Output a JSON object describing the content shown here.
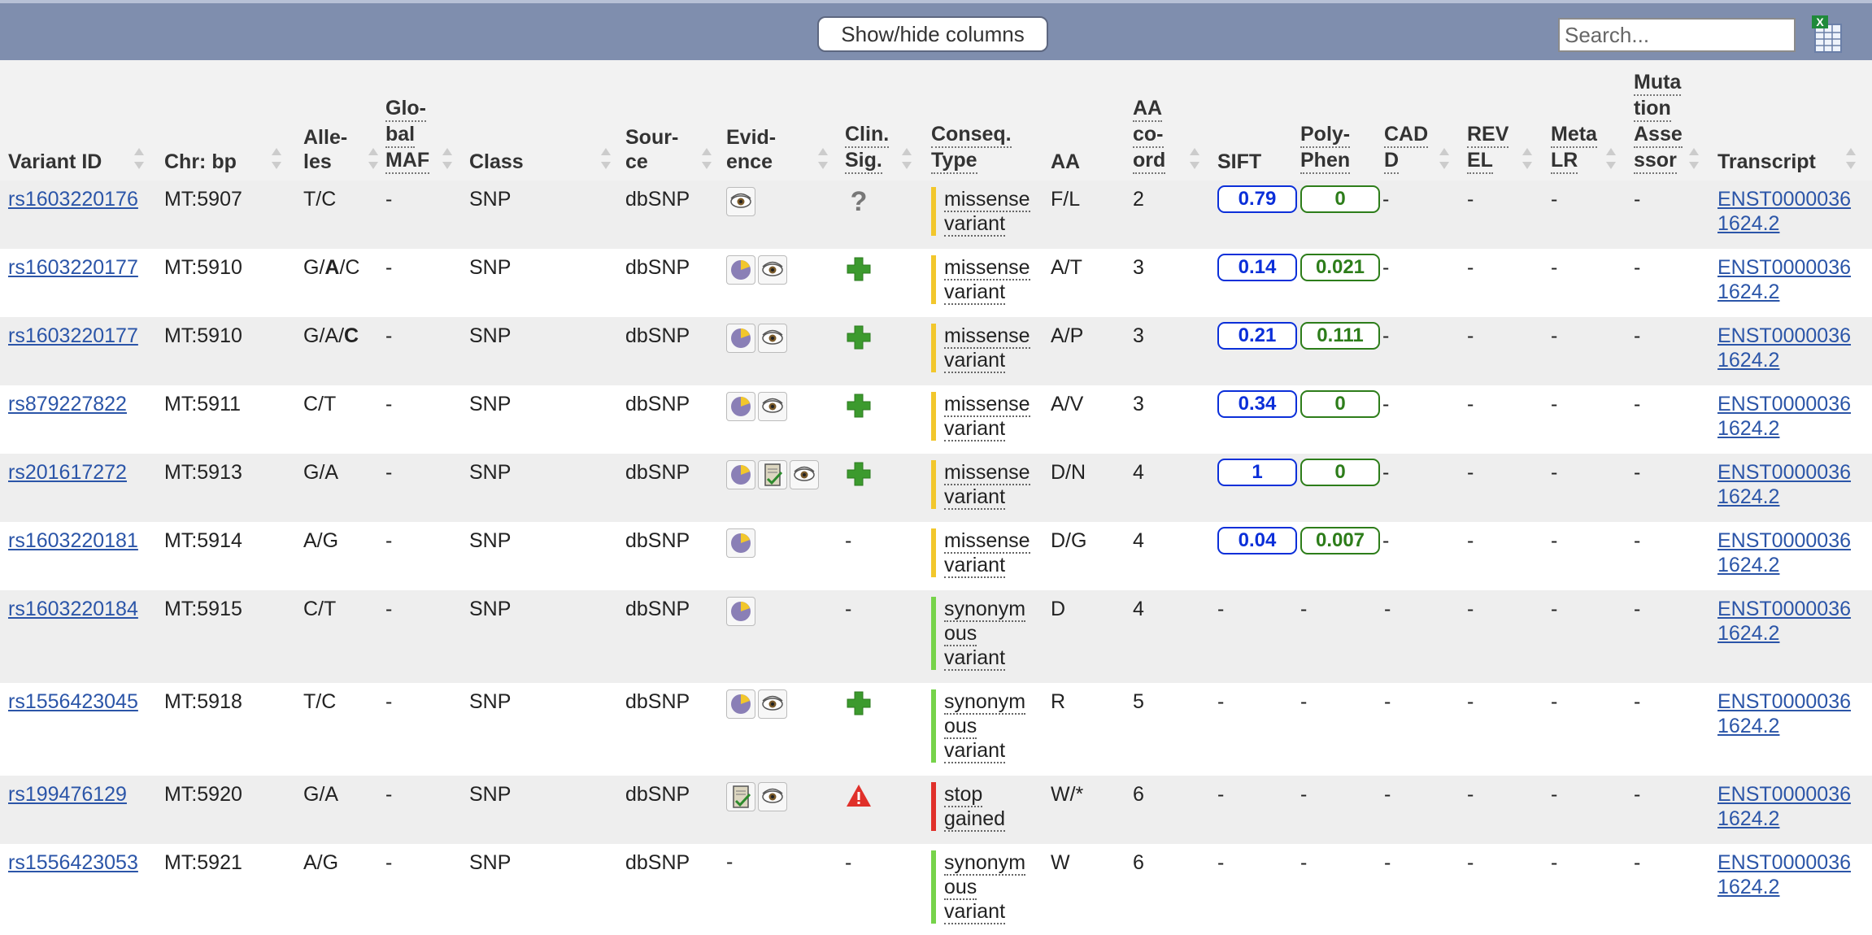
{
  "toolbar": {
    "show_hide_label": "Show/hide columns",
    "search_placeholder": "Search...",
    "export_icon": "excel-export-icon"
  },
  "columns": [
    {
      "key": "variant_id",
      "lines": [
        "Variant ID"
      ]
    },
    {
      "key": "chr_bp",
      "lines": [
        "Chr: bp"
      ]
    },
    {
      "key": "alleles",
      "lines": [
        "Alle-",
        "les"
      ]
    },
    {
      "key": "global_maf",
      "lines": [
        "Glo-",
        "bal",
        "MAF"
      ]
    },
    {
      "key": "class",
      "lines": [
        "Class"
      ]
    },
    {
      "key": "source",
      "lines": [
        "Sour-",
        "ce"
      ]
    },
    {
      "key": "evidence",
      "lines": [
        "Evid-",
        "ence"
      ]
    },
    {
      "key": "clin_sig",
      "lines": [
        "Clin.",
        "Sig."
      ]
    },
    {
      "key": "conseq",
      "lines": [
        "Conseq.",
        "Type"
      ]
    },
    {
      "key": "aa",
      "lines": [
        "AA"
      ]
    },
    {
      "key": "aa_coord",
      "lines": [
        "AA",
        "co-",
        "ord"
      ]
    },
    {
      "key": "sift",
      "lines": [
        "SIFT"
      ]
    },
    {
      "key": "polyphen",
      "lines": [
        "Poly-",
        "Phen"
      ]
    },
    {
      "key": "cadd",
      "lines": [
        "CAD",
        "D"
      ]
    },
    {
      "key": "revel",
      "lines": [
        "REV",
        "EL"
      ]
    },
    {
      "key": "metalr",
      "lines": [
        "Meta",
        "LR"
      ]
    },
    {
      "key": "mutass",
      "lines": [
        "Muta",
        "tion",
        "Asse",
        "ssor"
      ]
    },
    {
      "key": "transcript",
      "lines": [
        "Transcript"
      ]
    }
  ],
  "rows": [
    {
      "id": "rs1603220176",
      "chr": "MT:5907",
      "alleles": [
        "T/C"
      ],
      "maf": "-",
      "class": "SNP",
      "source": "dbSNP",
      "evidence": [
        "eye-icon"
      ],
      "clin": "uncertain-icon",
      "conseq": [
        "missense",
        "variant"
      ],
      "conseq_color": "#f2c72c",
      "aa": "F/L",
      "coord": "2",
      "sift": "0.79",
      "polyphen": "0",
      "cadd": "-",
      "revel": "-",
      "metalr": "-",
      "mutass": "-",
      "transcript": [
        "ENST0000036",
        "1624.2"
      ]
    },
    {
      "id": "rs1603220177",
      "chr": "MT:5910",
      "alleles": [
        "G/",
        "A",
        "/C"
      ],
      "maf": "-",
      "class": "SNP",
      "source": "dbSNP",
      "evidence": [
        "frequency-icon",
        "eye-icon"
      ],
      "clin": "benign-cross-icon",
      "conseq": [
        "missense",
        "variant"
      ],
      "conseq_color": "#f2c72c",
      "aa": "A/T",
      "coord": "3",
      "sift": "0.14",
      "polyphen": "0.021",
      "cadd": "-",
      "revel": "-",
      "metalr": "-",
      "mutass": "-",
      "transcript": [
        "ENST0000036",
        "1624.2"
      ]
    },
    {
      "id": "rs1603220177",
      "chr": "MT:5910",
      "alleles": [
        "G/A/",
        "C",
        ""
      ],
      "maf": "-",
      "class": "SNP",
      "source": "dbSNP",
      "evidence": [
        "frequency-icon",
        "eye-icon"
      ],
      "clin": "benign-cross-icon",
      "conseq": [
        "missense",
        "variant"
      ],
      "conseq_color": "#f2c72c",
      "aa": "A/P",
      "coord": "3",
      "sift": "0.21",
      "polyphen": "0.111",
      "cadd": "-",
      "revel": "-",
      "metalr": "-",
      "mutass": "-",
      "transcript": [
        "ENST0000036",
        "1624.2"
      ]
    },
    {
      "id": "rs879227822",
      "chr": "MT:5911",
      "alleles": [
        "C/T"
      ],
      "maf": "-",
      "class": "SNP",
      "source": "dbSNP",
      "evidence": [
        "frequency-icon",
        "eye-icon"
      ],
      "clin": "benign-cross-icon",
      "conseq": [
        "missense",
        "variant"
      ],
      "conseq_color": "#f2c72c",
      "aa": "A/V",
      "coord": "3",
      "sift": "0.34",
      "polyphen": "0",
      "cadd": "-",
      "revel": "-",
      "metalr": "-",
      "mutass": "-",
      "transcript": [
        "ENST0000036",
        "1624.2"
      ]
    },
    {
      "id": "rs201617272",
      "chr": "MT:5913",
      "alleles": [
        "G/A"
      ],
      "maf": "-",
      "class": "SNP",
      "source": "dbSNP",
      "evidence": [
        "frequency-icon",
        "citation-icon",
        "eye-icon"
      ],
      "clin": "benign-cross-icon",
      "conseq": [
        "missense",
        "variant"
      ],
      "conseq_color": "#f2c72c",
      "aa": "D/N",
      "coord": "4",
      "sift": "1",
      "polyphen": "0",
      "cadd": "-",
      "revel": "-",
      "metalr": "-",
      "mutass": "-",
      "transcript": [
        "ENST0000036",
        "1624.2"
      ]
    },
    {
      "id": "rs1603220181",
      "chr": "MT:5914",
      "alleles": [
        "A/G"
      ],
      "maf": "-",
      "class": "SNP",
      "source": "dbSNP",
      "evidence": [
        "frequency-icon"
      ],
      "clin": "-",
      "conseq": [
        "missense",
        "variant"
      ],
      "conseq_color": "#f2c72c",
      "aa": "D/G",
      "coord": "4",
      "sift": "0.04",
      "polyphen": "0.007",
      "cadd": "-",
      "revel": "-",
      "metalr": "-",
      "mutass": "-",
      "transcript": [
        "ENST0000036",
        "1624.2"
      ]
    },
    {
      "id": "rs1603220184",
      "chr": "MT:5915",
      "alleles": [
        "C/T"
      ],
      "maf": "-",
      "class": "SNP",
      "source": "dbSNP",
      "evidence": [
        "frequency-icon"
      ],
      "clin": "-",
      "conseq": [
        "synonym",
        "ous",
        "variant"
      ],
      "conseq_color": "#76d34a",
      "aa": "D",
      "coord": "4",
      "sift": "-",
      "polyphen": "-",
      "cadd": "-",
      "revel": "-",
      "metalr": "-",
      "mutass": "-",
      "transcript": [
        "ENST0000036",
        "1624.2"
      ]
    },
    {
      "id": "rs1556423045",
      "chr": "MT:5918",
      "alleles": [
        "T/C"
      ],
      "maf": "-",
      "class": "SNP",
      "source": "dbSNP",
      "evidence": [
        "frequency-icon",
        "eye-icon"
      ],
      "clin": "benign-cross-icon",
      "conseq": [
        "synonym",
        "ous",
        "variant"
      ],
      "conseq_color": "#76d34a",
      "aa": "R",
      "coord": "5",
      "sift": "-",
      "polyphen": "-",
      "cadd": "-",
      "revel": "-",
      "metalr": "-",
      "mutass": "-",
      "transcript": [
        "ENST0000036",
        "1624.2"
      ]
    },
    {
      "id": "rs199476129",
      "chr": "MT:5920",
      "alleles": [
        "G/A"
      ],
      "maf": "-",
      "class": "SNP",
      "source": "dbSNP",
      "evidence": [
        "citation-icon",
        "eye-icon"
      ],
      "clin": "pathogenic-warning-icon",
      "conseq": [
        "stop",
        "gained"
      ],
      "conseq_color": "#e0302a",
      "aa": "W/*",
      "coord": "6",
      "sift": "-",
      "polyphen": "-",
      "cadd": "-",
      "revel": "-",
      "metalr": "-",
      "mutass": "-",
      "transcript": [
        "ENST0000036",
        "1624.2"
      ]
    },
    {
      "id": "rs1556423053",
      "chr": "MT:5921",
      "alleles": [
        "A/G"
      ],
      "maf": "-",
      "class": "SNP",
      "source": "dbSNP",
      "evidence": [
        "-"
      ],
      "clin": "-",
      "conseq": [
        "synonym",
        "ous",
        "variant"
      ],
      "conseq_color": "#76d34a",
      "aa": "W",
      "coord": "6",
      "sift": "-",
      "polyphen": "-",
      "cadd": "-",
      "revel": "-",
      "metalr": "-",
      "mutass": "-",
      "transcript": [
        "ENST0000036",
        "1624.2"
      ]
    }
  ]
}
